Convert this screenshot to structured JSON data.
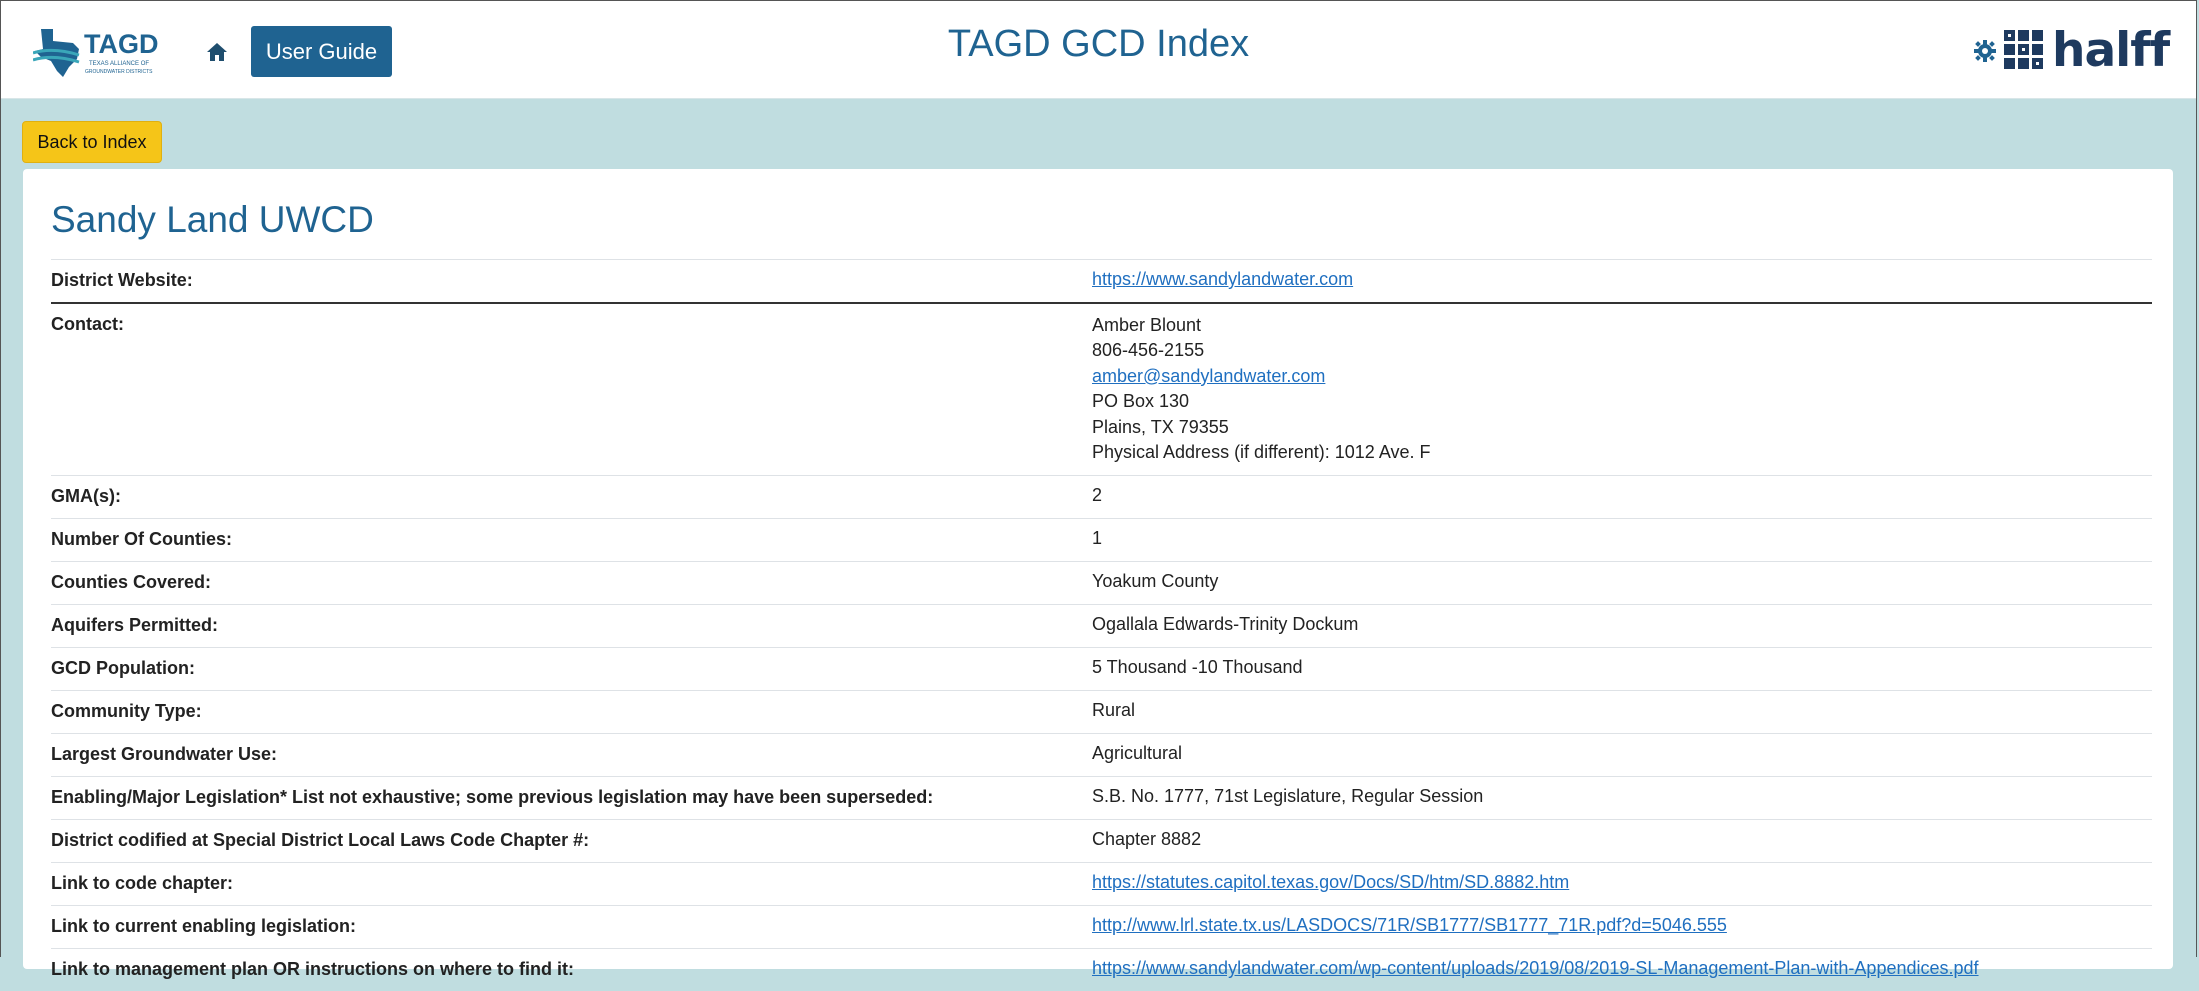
{
  "header": {
    "logo_text": "TAGD",
    "logo_subtext": "TEXAS ALLIANCE OF GROUNDWATER DISTRICTS",
    "user_guide_label": "User Guide",
    "title": "TAGD GCD Index",
    "partner_logo_text": "halff"
  },
  "back_label": "Back to Index",
  "district": {
    "name": "Sandy Land UWCD",
    "fields": [
      {
        "label": "District Website:",
        "value": "https://www.sandylandwater.com",
        "link": true
      },
      {
        "label": "Contact:",
        "lines": [
          {
            "text": "Amber Blount"
          },
          {
            "text": "806-456-2155"
          },
          {
            "text": "amber@sandylandwater.com",
            "link": true
          },
          {
            "text": "PO Box 130"
          },
          {
            "text": "Plains, TX 79355"
          },
          {
            "text": "Physical Address (if different): 1012 Ave. F"
          }
        ]
      },
      {
        "label": "GMA(s):",
        "value": "2"
      },
      {
        "label": "Number Of Counties:",
        "value": "1"
      },
      {
        "label": "Counties Covered:",
        "value": "Yoakum County"
      },
      {
        "label": "Aquifers Permitted:",
        "value": "Ogallala Edwards-Trinity Dockum"
      },
      {
        "label": "GCD Population:",
        "value": "5 Thousand -10 Thousand"
      },
      {
        "label": "Community Type:",
        "value": "Rural"
      },
      {
        "label": "Largest Groundwater Use:",
        "value": "Agricultural"
      },
      {
        "label": "Enabling/Major Legislation* List not exhaustive; some previous legislation may have been superseded:",
        "value": "S.B. No. 1777, 71st Legislature, Regular Session"
      },
      {
        "label": "District codified at Special District Local Laws Code Chapter #:",
        "value": "Chapter 8882"
      },
      {
        "label": "Link to code chapter:",
        "value": "https://statutes.capitol.texas.gov/Docs/SD/htm/SD.8882.htm",
        "link": true
      },
      {
        "label": "Link to current enabling legislation:",
        "value": "http://www.lrl.state.tx.us/LASDOCS/71R/SB1777/SB1777_71R.pdf?d=5046.555",
        "link": true
      },
      {
        "label": "Link to management plan OR instructions on where to find it:",
        "value": "https://www.sandylandwater.com/wp-content/uploads/2019/08/2019-SL-Management-Plan-with-Appendices.pdf",
        "link": true
      }
    ]
  },
  "colors": {
    "brand": "#1f6391",
    "page_bg": "#c0dde0",
    "back_button": "#f5c518",
    "link": "#1f6fc0"
  },
  "icons": [
    "texas-map-icon",
    "home-icon",
    "gear-icon",
    "halff-grid-icon"
  ]
}
